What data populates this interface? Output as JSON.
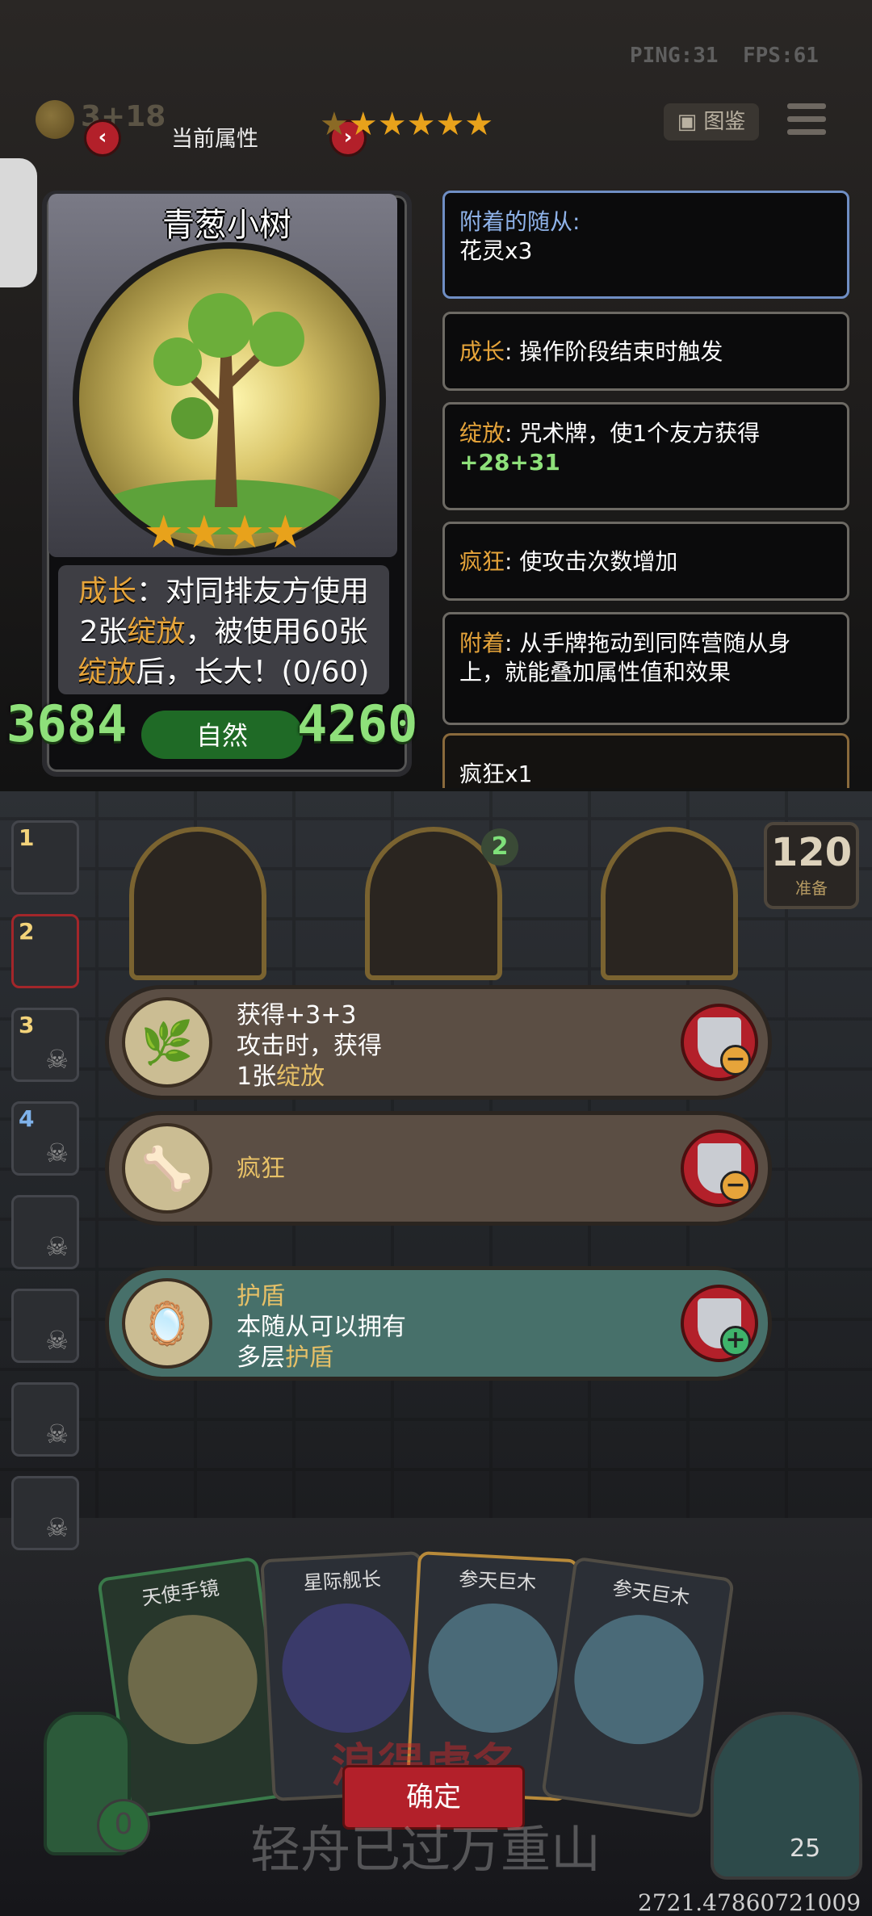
{
  "hud": {
    "ping": "PING:31",
    "fps": "FPS:61",
    "coins": "3+18"
  },
  "header": {
    "title": "当前属性",
    "prev_icon": "chevron-left-icon",
    "next_icon": "chevron-right-icon",
    "star_count": 6
  },
  "toolbar": {
    "atlas_label": "图鉴",
    "menu_icon": "hamburger-icon"
  },
  "card": {
    "name": "青葱小树",
    "stars": 4,
    "desc_l1_a": "成长",
    "desc_l1_b": "：对同排友方使用",
    "desc_l2_a": "2张",
    "desc_l2_b": "绽放",
    "desc_l2_c": "，被使用60张",
    "desc_l3_a": "绽放",
    "desc_l3_b": "后，长大！(0/60)",
    "attack": "3684",
    "attribute": "自然",
    "health": "4260"
  },
  "info": {
    "attached_label": "附着的随从:",
    "attached_value": "花灵x3",
    "growth_key": "成长",
    "growth_text": ": 操作阶段结束时触发",
    "bloom_key": "绽放",
    "bloom_text": ": 咒术牌，使1个友方获得",
    "bloom_value": "+28+31",
    "frenzy_key": "疯狂",
    "frenzy_text": ": 使攻击次数增加",
    "attach_key": "附着",
    "attach_text": ": 从手牌拖动到同阵营随从身上，就能叠加属性值和效果",
    "frenzy_stack": "疯狂x1"
  },
  "team": {
    "slots": [
      "1",
      "2",
      "3",
      "4"
    ],
    "ready_count": "120",
    "ready_label": "准备",
    "badge": "2"
  },
  "buffs": [
    {
      "title": "获得+3+3",
      "line2": "攻击时，获得",
      "line3_a": "1张",
      "line3_b": "绽放",
      "icon": "branch-icon",
      "action": "remove"
    },
    {
      "title": "疯狂",
      "icon": "horn-icon",
      "action": "remove"
    },
    {
      "title": "护盾",
      "line2": "本随从可以拥有",
      "line3_a": "多层",
      "line3_b": "护盾",
      "icon": "mirror-icon",
      "action": "add"
    }
  ],
  "hand": [
    {
      "name": "天使手镜"
    },
    {
      "name": "星际舰长"
    },
    {
      "name": "参天巨木"
    },
    {
      "name": "参天巨木"
    }
  ],
  "footer": {
    "confirm_label": "确定",
    "watermark_red": "浪得虚名",
    "watermark_grey": "轻舟已过万重山",
    "coords": "2721.47860721009",
    "hp": "25",
    "deck": "0"
  }
}
